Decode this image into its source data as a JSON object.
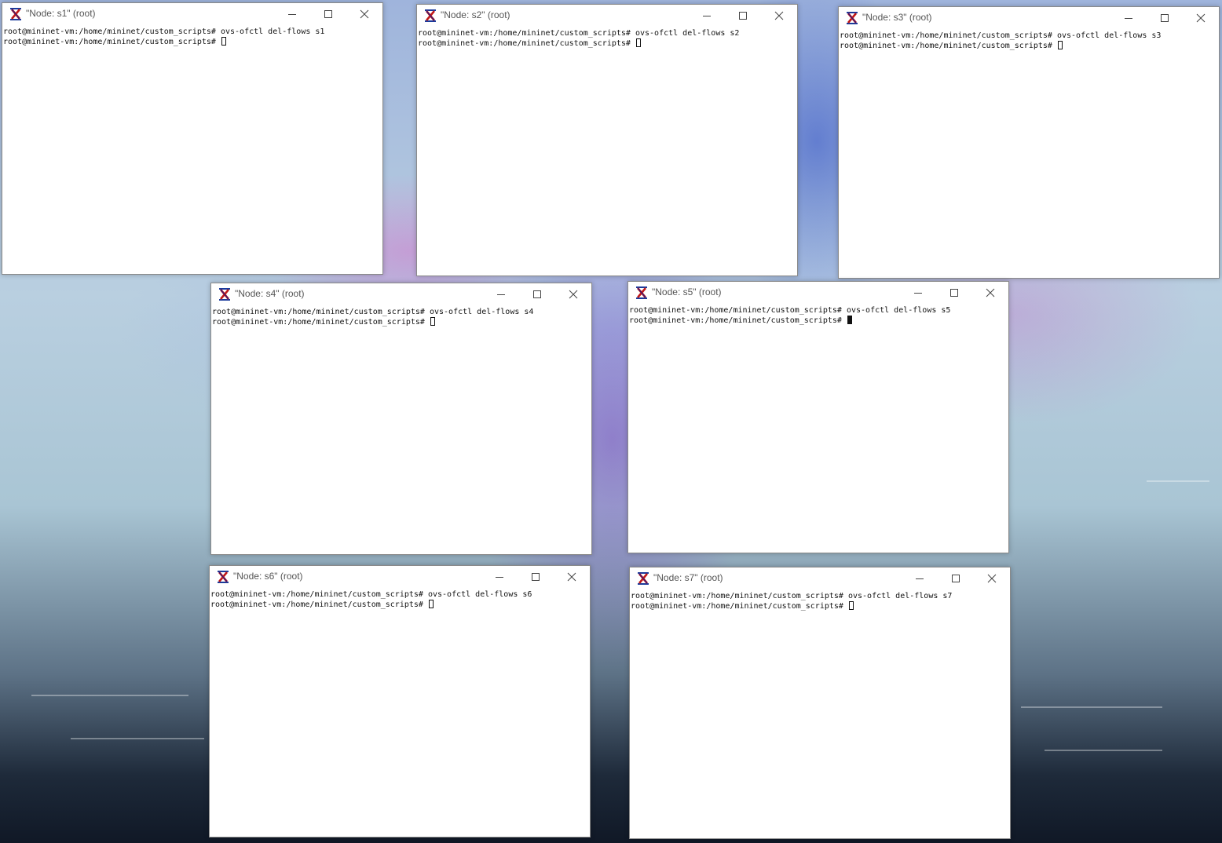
{
  "windows": [
    {
      "title": "\"Node: s1\" (root)",
      "prompt": "root@mininet-vm:/home/mininet/custom_scripts#",
      "command": "ovs-ofctl del-flows s1",
      "cursor_filled": false
    },
    {
      "title": "\"Node: s2\" (root)",
      "prompt": "root@mininet-vm:/home/mininet/custom_scripts#",
      "command": "ovs-ofctl del-flows s2",
      "cursor_filled": false
    },
    {
      "title": "\"Node: s3\" (root)",
      "prompt": "root@mininet-vm:/home/mininet/custom_scripts#",
      "command": "ovs-ofctl del-flows s3",
      "cursor_filled": false
    },
    {
      "title": "\"Node: s4\" (root)",
      "prompt": "root@mininet-vm:/home/mininet/custom_scripts#",
      "command": "ovs-ofctl del-flows s4",
      "cursor_filled": false
    },
    {
      "title": "\"Node: s5\" (root)",
      "prompt": "root@mininet-vm:/home/mininet/custom_scripts#",
      "command": "ovs-ofctl del-flows s5",
      "cursor_filled": true
    },
    {
      "title": "\"Node: s6\" (root)",
      "prompt": "root@mininet-vm:/home/mininet/custom_scripts#",
      "command": "ovs-ofctl del-flows s6",
      "cursor_filled": false
    },
    {
      "title": "\"Node: s7\" (root)",
      "prompt": "root@mininet-vm:/home/mininet/custom_scripts#",
      "command": "ovs-ofctl del-flows s7",
      "cursor_filled": false
    }
  ],
  "icons": {
    "app": "x-window-icon",
    "minimize": "minimize-icon",
    "maximize": "maximize-icon",
    "close": "close-icon"
  }
}
